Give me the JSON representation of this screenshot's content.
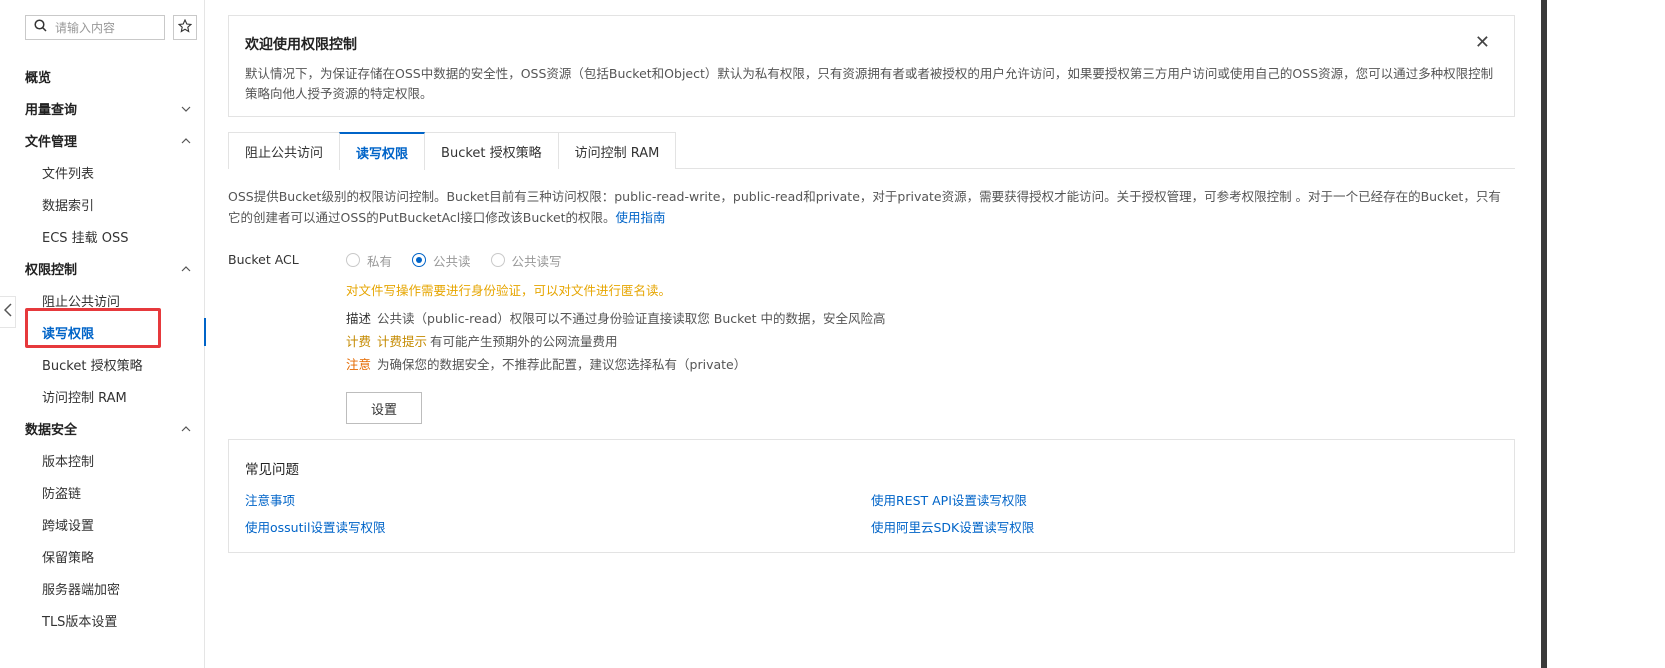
{
  "sidebar": {
    "search_placeholder": "请输入内容",
    "groups": [
      {
        "label": "概览"
      },
      {
        "label": "用量查询"
      },
      {
        "label": "文件管理",
        "items": [
          "文件列表",
          "数据索引",
          "ECS 挂载 OSS"
        ]
      },
      {
        "label": "权限控制",
        "items": [
          "阻止公共访问",
          "读写权限",
          "Bucket 授权策略",
          "访问控制 RAM"
        ]
      },
      {
        "label": "数据安全",
        "items": [
          "版本控制",
          "防盗链",
          "跨域设置",
          "保留策略",
          "服务器端加密",
          "TLS版本设置"
        ]
      }
    ],
    "active_item": "读写权限"
  },
  "banner": {
    "title": "欢迎使用权限控制",
    "text": "默认情况下，为保证存储在OSS中数据的安全性，OSS资源（包括Bucket和Object）默认为私有权限，只有资源拥有者或者被授权的用户允许访问，如果要授权第三方用户访问或使用自己的OSS资源，您可以通过多种权限控制策略向他人授予资源的特定权限。"
  },
  "tabs": [
    "阻止公共访问",
    "读写权限",
    "Bucket 授权策略",
    "访问控制 RAM"
  ],
  "active_tab": "读写权限",
  "description": {
    "text": "OSS提供Bucket级别的权限访问控制。Bucket目前有三种访问权限：public-read-write，public-read和private，对于private资源，需要获得授权才能访问。关于授权管理，可参考权限控制 。对于一个已经存在的Bucket，只有它的创建者可以通过OSS的PutBucketAcl接口修改该Bucket的权限。",
    "link": "使用指南"
  },
  "acl": {
    "label": "Bucket ACL",
    "options": [
      "私有",
      "公共读",
      "公共读写"
    ],
    "selected": "公共读",
    "warning": "对文件写操作需要进行身份验证，可以对文件进行匿名读。",
    "desc_key": "描述",
    "desc_text": "公共读（public-read）权限可以不通过身份验证直接读取您 Bucket 中的数据，安全风险高",
    "fee_key": "计费",
    "fee_tip": "计费提示",
    "fee_text": "有可能产生预期外的公网流量费用",
    "note_key": "注意",
    "note_text": "为确保您的数据安全，不推荐此配置，建议您选择私有（private）",
    "button": "设置"
  },
  "faq": {
    "title": "常见问题",
    "links": [
      "注意事项",
      "使用REST API设置读写权限",
      "使用ossutil设置读写权限",
      "使用阿里云SDK设置读写权限"
    ]
  },
  "colors": {
    "accent": "#0064c8",
    "warning": "#e6a500",
    "highlight": "#e6393c"
  }
}
